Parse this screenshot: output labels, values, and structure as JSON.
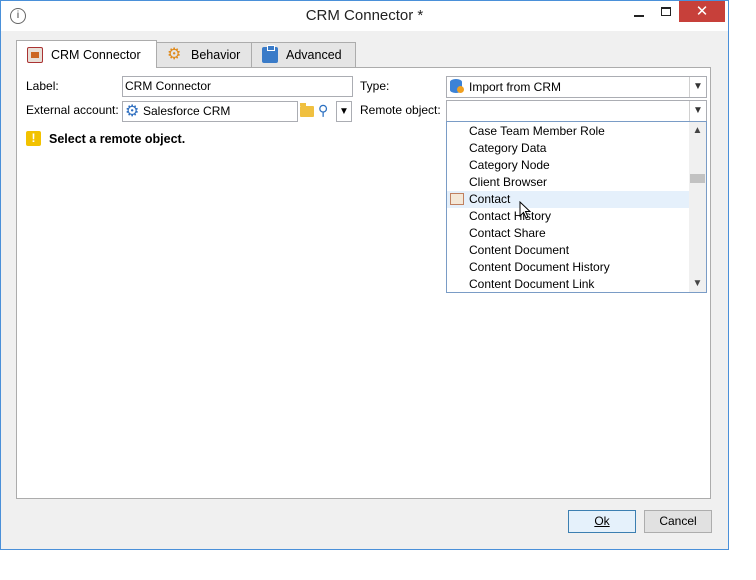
{
  "window": {
    "title": "CRM Connector *",
    "close_glyph": "✕"
  },
  "tabs": [
    {
      "label": "CRM Connector",
      "icon": "crm-icon",
      "active": true
    },
    {
      "label": "Behavior",
      "icon": "gear-icon",
      "active": false
    },
    {
      "label": "Advanced",
      "icon": "clipboard-icon",
      "active": false
    }
  ],
  "form": {
    "label_label": "Label:",
    "label_value": "CRM Connector",
    "type_label": "Type:",
    "type_value": "Import from CRM",
    "external_account_label": "External account:",
    "external_account_value": "Salesforce CRM",
    "remote_object_label": "Remote object:",
    "remote_object_value": ""
  },
  "warning": {
    "text": "Select a remote object.",
    "glyph": "!"
  },
  "dropdown": {
    "items": [
      "Case Team Member Role",
      "Category Data",
      "Category Node",
      "Client Browser",
      "Contact",
      "Contact History",
      "Contact Share",
      "Content Document",
      "Content Document History",
      "Content Document Link"
    ],
    "hovered_item": "Contact"
  },
  "buttons": {
    "ok_label": "Ok",
    "cancel_label": "Cancel"
  },
  "colors": {
    "close_button": "#c7403a",
    "warning": "#f2c200",
    "hover": "#e5f0fb",
    "accent": "#3c7fb1"
  }
}
